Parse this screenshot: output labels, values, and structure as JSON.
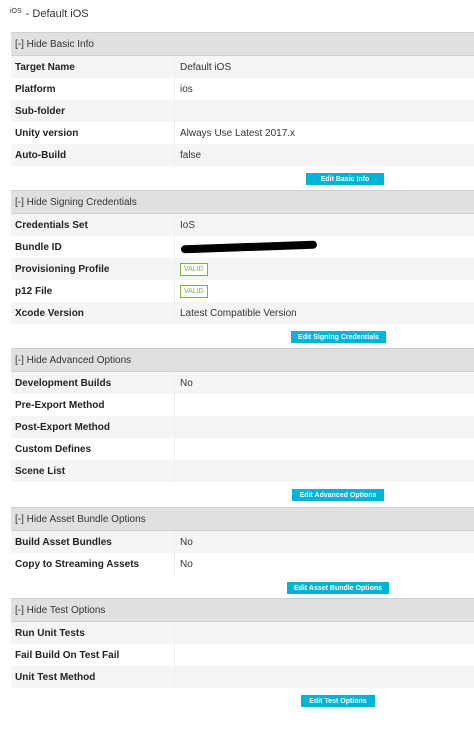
{
  "header": {
    "platform_icon": "iOS",
    "title": "- Default iOS"
  },
  "sections": {
    "basic": {
      "toggle_label": "[-] Hide Basic Info",
      "rows": [
        {
          "label": "Target Name",
          "value": "Default iOS"
        },
        {
          "label": "Platform",
          "value": "ios"
        },
        {
          "label": "Sub-folder",
          "value": ""
        },
        {
          "label": "Unity version",
          "value": "Always Use Latest 2017.x"
        },
        {
          "label": "Auto-Build",
          "value": "false"
        }
      ],
      "button": "Edit Basic Info"
    },
    "signing": {
      "toggle_label": "[-] Hide Signing Credentials",
      "rows": [
        {
          "label": "Credentials Set",
          "value": "IoS"
        },
        {
          "label": "Bundle ID",
          "value": ""
        },
        {
          "label": "Provisioning Profile",
          "value": "VALID"
        },
        {
          "label": "p12 File",
          "value": "VALID"
        },
        {
          "label": "Xcode Version",
          "value": "Latest Compatible Version"
        }
      ],
      "button": "Edit Signing Credentials"
    },
    "advanced": {
      "toggle_label": "[-] Hide Advanced Options",
      "rows": [
        {
          "label": "Development Builds",
          "value": "No"
        },
        {
          "label": "Pre-Export Method",
          "value": ""
        },
        {
          "label": "Post-Export Method",
          "value": ""
        },
        {
          "label": "Custom Defines",
          "value": ""
        },
        {
          "label": "Scene List",
          "value": ""
        }
      ],
      "button": "Edit Advanced Options"
    },
    "asset_bundle": {
      "toggle_label": "[-] Hide Asset Bundle Options",
      "rows": [
        {
          "label": "Build Asset Bundles",
          "value": "No"
        },
        {
          "label": "Copy to Streaming Assets",
          "value": "No"
        }
      ],
      "button": "Edit Asset Bundle Options"
    },
    "test": {
      "toggle_label": "[-] Hide Test Options",
      "rows": [
        {
          "label": "Run Unit Tests",
          "value": ""
        },
        {
          "label": "Fail Build On Test Fail",
          "value": ""
        },
        {
          "label": "Unit Test Method",
          "value": ""
        }
      ],
      "button": "Edit Test Options"
    }
  },
  "colors": {
    "accent_button": "#00b4d8",
    "valid_badge": "#7cb342",
    "section_header_bg": "#e0e0e0"
  }
}
